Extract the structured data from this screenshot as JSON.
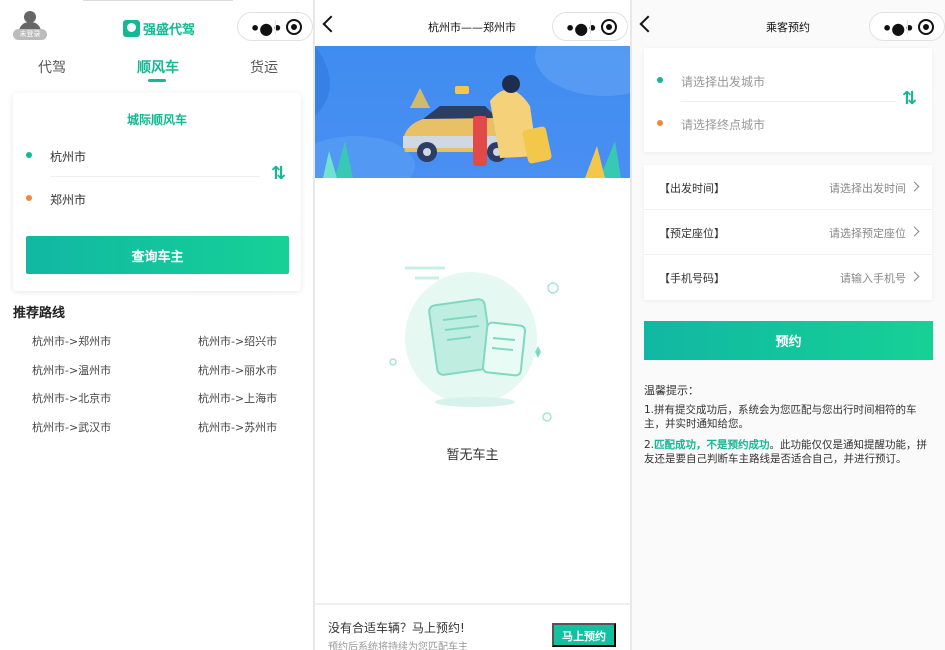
{
  "colors": {
    "accent": "#14b893",
    "orange": "#f08a3a",
    "banner_blue": "#3f8cf0"
  },
  "capsule": {
    "more_icon": "more-dots-icon",
    "close_icon": "target-close-icon"
  },
  "screen1": {
    "avatar_label": "未登录",
    "brand_name": "强盛代驾",
    "tabs": [
      "代驾",
      "顺风车",
      "货运"
    ],
    "active_tab": "顺风车",
    "card_title": "城际顺风车",
    "from_city": "杭州市",
    "to_city": "郑州市",
    "search_button": "查询车主",
    "recommend_title": "推荐路线",
    "routes": [
      "杭州市->郑州市",
      "杭州市->绍兴市",
      "杭州市->温州市",
      "杭州市->丽水市",
      "杭州市->北京市",
      "杭州市->上海市",
      "杭州市->武汉市",
      "杭州市->苏州市"
    ]
  },
  "screen2": {
    "title": "杭州市——郑州市",
    "empty_text": "暂无车主",
    "bottom_main": "没有合适车辆？马上预约!",
    "bottom_sub": "预约后系统将持续为您匹配车主",
    "bottom_button": "马上预约"
  },
  "screen3": {
    "title": "乘客预约",
    "from_placeholder": "请选择出发城市",
    "to_placeholder": "请选择终点城市",
    "rows": [
      {
        "label": "【出发时间】",
        "value": "请选择出发时间"
      },
      {
        "label": "【预定座位】",
        "value": "请选择预定座位"
      },
      {
        "label": "【手机号码】",
        "value": "请输入手机号"
      }
    ],
    "submit_button": "预约",
    "tips_title": "温馨提示：",
    "tip1": "1.拼有提交成功后，系统会为您匹配与您出行时间相符的车主，并实时通知给您。",
    "tip2_prefix": "2.",
    "tip2_highlight": "匹配成功，不是预约成功",
    "tip2_rest": "。此功能仅仅是通知提醒功能，拼友还是要自己判断车主路线是否适合自己，并进行预订。"
  }
}
